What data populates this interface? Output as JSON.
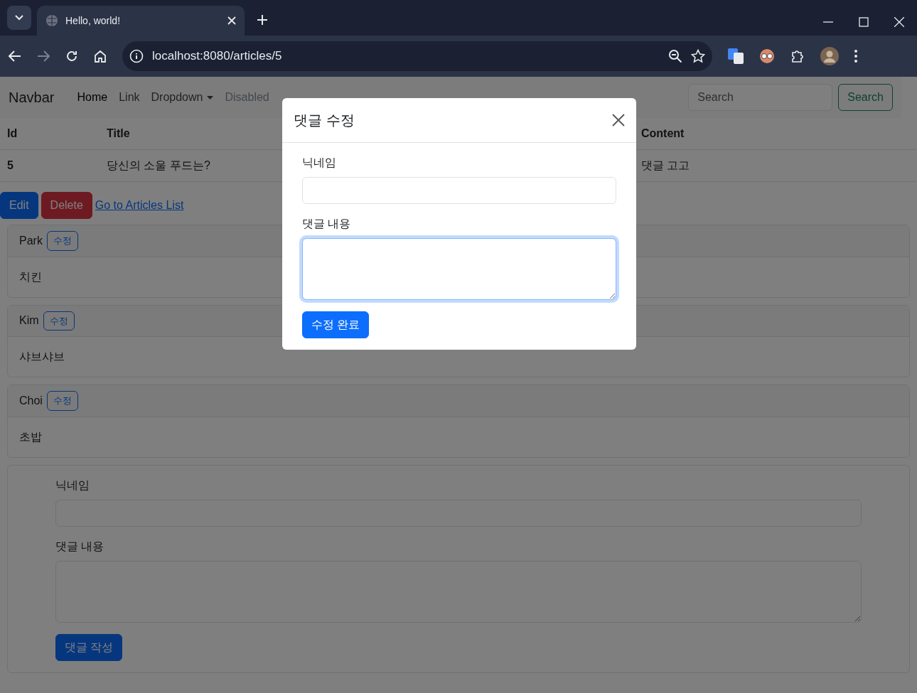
{
  "browser": {
    "tab_title": "Hello, world!",
    "address": "localhost:8080/articles/5"
  },
  "navbar": {
    "brand": "Navbar",
    "links": [
      {
        "label": "Home",
        "kind": "link",
        "active": true,
        "disabled": false
      },
      {
        "label": "Link",
        "kind": "link",
        "active": false,
        "disabled": false
      },
      {
        "label": "Dropdown",
        "kind": "dropdown",
        "active": false,
        "disabled": false
      },
      {
        "label": "Disabled",
        "kind": "link",
        "active": false,
        "disabled": true
      }
    ],
    "search": {
      "placeholder": "Search",
      "button": "Search"
    }
  },
  "table": {
    "columns": [
      "Id",
      "Title",
      "Content"
    ],
    "rows": [
      [
        "5",
        "당신의 소울 푸드는?",
        "댓글 고고"
      ]
    ]
  },
  "actions": [
    {
      "label": "Edit",
      "kind": "primary"
    },
    {
      "label": "Delete",
      "kind": "danger"
    },
    {
      "label": "Go to Articles List",
      "kind": "link"
    }
  ],
  "comments": [
    {
      "nickname": "Park",
      "edit_button": "수정",
      "body": "치킨"
    },
    {
      "nickname": "Kim",
      "edit_button": "수정",
      "body": "샤브샤브"
    },
    {
      "nickname": "Choi",
      "edit_button": "수정",
      "body": "초밥"
    }
  ],
  "new_comment_form": {
    "fields": [
      {
        "label": "닉네임",
        "kind": "input"
      },
      {
        "label": "댓글 내용",
        "kind": "textarea"
      }
    ],
    "submit": "댓글 작성"
  },
  "modal": {
    "title": "댓글 수정",
    "fields": [
      {
        "label": "닉네임",
        "kind": "input",
        "focused": false
      },
      {
        "label": "댓글 내용",
        "kind": "textarea",
        "focused": true
      }
    ],
    "submit": "수정 완료"
  }
}
